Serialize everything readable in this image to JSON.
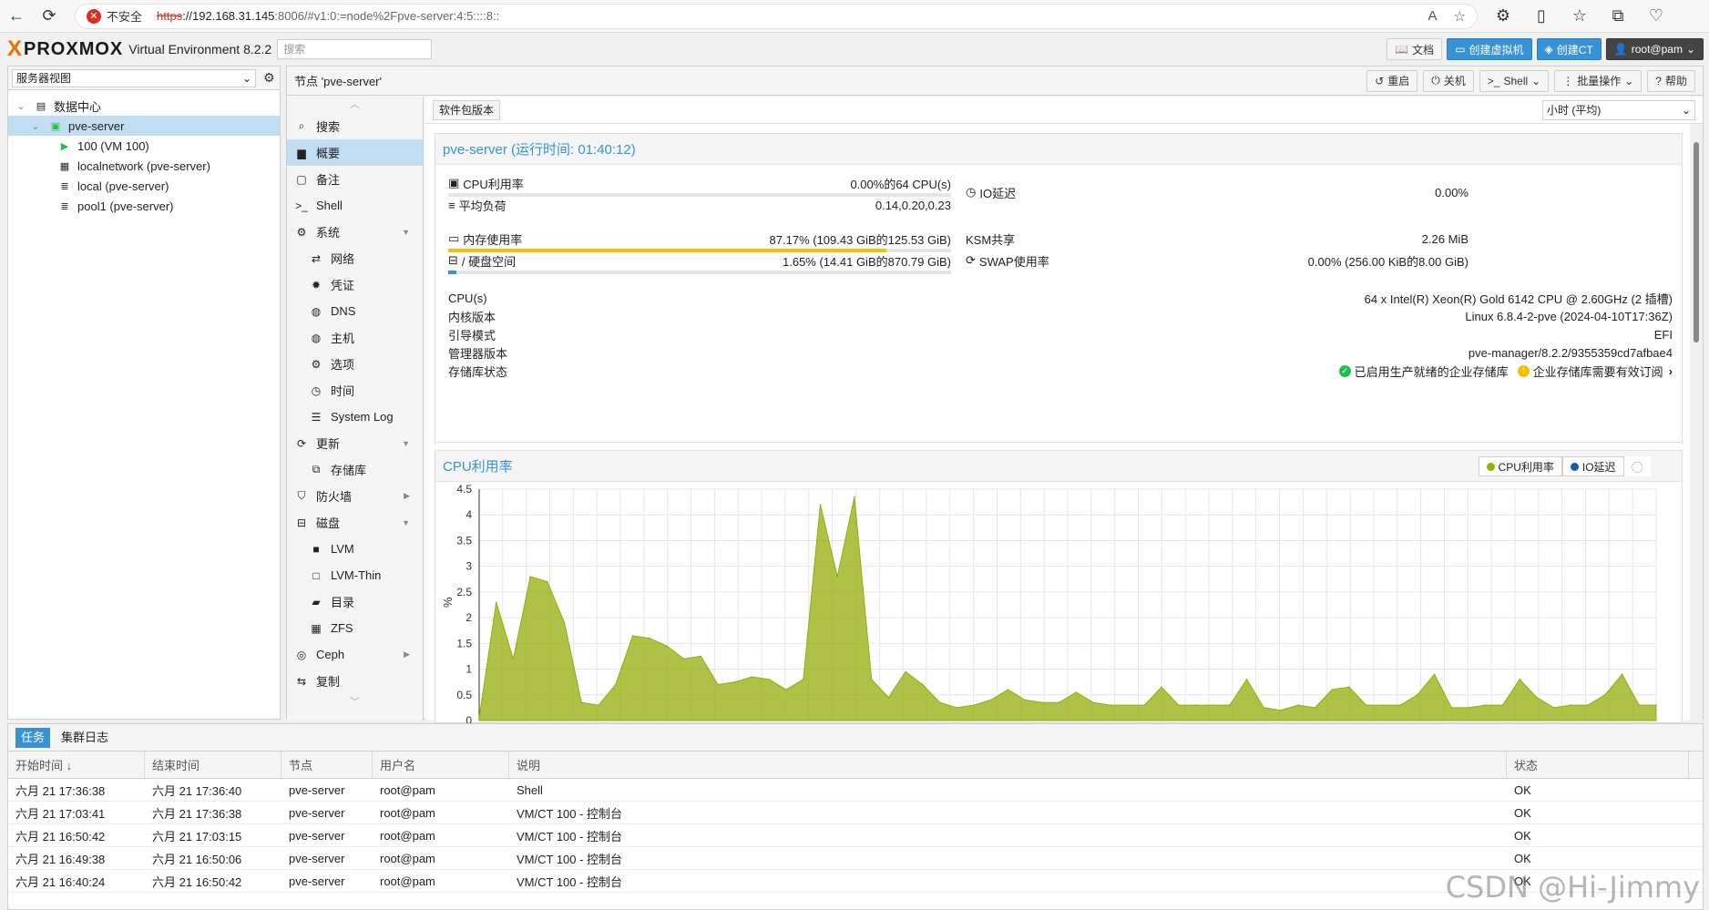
{
  "browser": {
    "insecure_label": "不安全",
    "url_scheme": "https",
    "url_host": "://192.168.31.145",
    "url_rest": ":8006/#v1:0:=node%2Fpve-server:4:5::::8::"
  },
  "header": {
    "logo_text": "PROXMOX",
    "version": "Virtual Environment 8.2.2",
    "search_placeholder": "搜索",
    "docs": "文档",
    "create_vm": "创建虚拟机",
    "create_ct": "创建CT",
    "user": "root@pam"
  },
  "tree": {
    "view": "服务器视图",
    "items": [
      {
        "label": "数据中心",
        "icon": "datacenter-icon"
      },
      {
        "label": "pve-server",
        "icon": "server-online-icon"
      },
      {
        "label": "100 (VM 100)",
        "icon": "vm-running-icon"
      },
      {
        "label": "localnetwork (pve-server)",
        "icon": "network-grid-icon"
      },
      {
        "label": "local (pve-server)",
        "icon": "storage-icon"
      },
      {
        "label": "pool1 (pve-server)",
        "icon": "storage-icon"
      }
    ]
  },
  "node": {
    "title": "节点 'pve-server'",
    "reboot": "重启",
    "shutdown": "关机",
    "shell": "Shell",
    "bulk": "批量操作",
    "help": "帮助"
  },
  "menu": [
    {
      "label": "搜索",
      "icon": "search-icon",
      "sub": false
    },
    {
      "label": "概要",
      "icon": "book-icon",
      "sub": false,
      "selected": true
    },
    {
      "label": "备注",
      "icon": "note-icon",
      "sub": false
    },
    {
      "label": "Shell",
      "icon": "terminal-icon",
      "sub": false
    },
    {
      "label": "系统",
      "icon": "cogs-icon",
      "sub": false,
      "arrow": "▼"
    },
    {
      "label": "网络",
      "icon": "exchange-icon",
      "sub": true
    },
    {
      "label": "凭证",
      "icon": "certificate-icon",
      "sub": true
    },
    {
      "label": "DNS",
      "icon": "globe-icon",
      "sub": true
    },
    {
      "label": "主机",
      "icon": "globe-icon",
      "sub": true
    },
    {
      "label": "选项",
      "icon": "gear-icon",
      "sub": true
    },
    {
      "label": "时间",
      "icon": "clock-icon",
      "sub": true
    },
    {
      "label": "System Log",
      "icon": "list-icon",
      "sub": true
    },
    {
      "label": "更新",
      "icon": "refresh-icon",
      "sub": false,
      "arrow": "▼"
    },
    {
      "label": "存储库",
      "icon": "files-icon",
      "sub": true
    },
    {
      "label": "防火墙",
      "icon": "shield-icon",
      "sub": false,
      "arrow": "▶"
    },
    {
      "label": "磁盘",
      "icon": "hdd-icon",
      "sub": false,
      "arrow": "▼"
    },
    {
      "label": "LVM",
      "icon": "square-icon",
      "sub": true
    },
    {
      "label": "LVM-Thin",
      "icon": "square-outline-icon",
      "sub": true
    },
    {
      "label": "目录",
      "icon": "folder-icon",
      "sub": true
    },
    {
      "label": "ZFS",
      "icon": "grid-icon",
      "sub": true
    },
    {
      "label": "Ceph",
      "icon": "ceph-icon",
      "sub": false,
      "arrow": "▶"
    },
    {
      "label": "复制",
      "icon": "retweet-icon",
      "sub": false
    }
  ],
  "content": {
    "pkg_versions": "软件包版本",
    "timeframe": "小时 (平均)",
    "summary_title": "pve-server (运行时间: 01:40:12)",
    "cpu_label": "CPU利用率",
    "cpu_value": "0.00%的64 CPU(s)",
    "cpu_fraction": 0.0,
    "load_label": "平均负荷",
    "load_value": "0.14,0.20,0.23",
    "io_label": "IO延迟",
    "io_value": "0.00%",
    "mem_label": "内存使用率",
    "mem_value": "87.17% (109.43 GiB的125.53 GiB)",
    "mem_fraction": 0.8717,
    "ksm_label": "KSM共享",
    "ksm_value": "2.26 MiB",
    "disk_label": "/ 硬盘空间",
    "disk_value": "1.65% (14.41 GiB的870.79 GiB)",
    "disk_fraction": 0.0165,
    "swap_label": "SWAP使用率",
    "swap_value": "0.00% (256.00 KiB的8.00 GiB)",
    "info": [
      {
        "label": "CPU(s)",
        "value": "64 x Intel(R) Xeon(R) Gold 6142 CPU @ 2.60GHz (2 插槽)"
      },
      {
        "label": "内核版本",
        "value": "Linux 6.8.4-2-pve (2024-04-10T17:36Z)"
      },
      {
        "label": "引导模式",
        "value": "EFI"
      },
      {
        "label": "管理器版本",
        "value": "pve-manager/8.2.2/9355359cd7afbae4"
      }
    ],
    "repo_label": "存储库状态",
    "repo_ok": "已启用生产就绪的企业存储库",
    "repo_warn": "企业存储库需要有效订阅"
  },
  "chart_data": {
    "type": "area",
    "title": "CPU利用率",
    "ylabel": "%",
    "ylim": [
      0,
      4.5
    ],
    "yticks": [
      "0",
      "0.5",
      "1",
      "1.5",
      "2",
      "2.5",
      "3",
      "3.5",
      "4",
      "4.5"
    ],
    "series": [
      {
        "name": "CPU利用率",
        "color": "#94ae0a",
        "values": [
          0.05,
          2.3,
          1.2,
          2.8,
          2.7,
          1.9,
          0.35,
          0.3,
          0.7,
          1.65,
          1.6,
          1.45,
          1.2,
          1.25,
          0.7,
          0.75,
          0.85,
          0.8,
          0.6,
          0.8,
          4.2,
          2.8,
          4.35,
          0.8,
          0.45,
          0.95,
          0.7,
          0.35,
          0.25,
          0.3,
          0.4,
          0.6,
          0.4,
          0.35,
          0.35,
          0.55,
          0.35,
          0.3,
          0.3,
          0.3,
          0.65,
          0.3,
          0.3,
          0.3,
          0.3,
          0.8,
          0.25,
          0.2,
          0.3,
          0.25,
          0.6,
          0.65,
          0.3,
          0.3,
          0.3,
          0.5,
          0.9,
          0.25,
          0.25,
          0.3,
          0.3,
          0.8,
          0.45,
          0.25,
          0.3,
          0.3,
          0.5,
          0.9,
          0.3,
          0.3
        ]
      },
      {
        "name": "IO延迟",
        "color": "#115fa6",
        "values": []
      }
    ],
    "legend": "top-right",
    "grid": true
  },
  "tasks": {
    "tab_tasks": "任务",
    "tab_cluster_log": "集群日志",
    "columns": [
      "开始时间 ↓",
      "结束时间",
      "节点",
      "用户名",
      "说明",
      "状态"
    ],
    "rows": [
      [
        "六月 21 17:36:38",
        "六月 21 17:36:40",
        "pve-server",
        "root@pam",
        "Shell",
        "OK"
      ],
      [
        "六月 21 17:03:41",
        "六月 21 17:36:38",
        "pve-server",
        "root@pam",
        "VM/CT 100 - 控制台",
        "OK"
      ],
      [
        "六月 21 16:50:42",
        "六月 21 17:03:15",
        "pve-server",
        "root@pam",
        "VM/CT 100 - 控制台",
        "OK"
      ],
      [
        "六月 21 16:49:38",
        "六月 21 16:50:06",
        "pve-server",
        "root@pam",
        "VM/CT 100 - 控制台",
        "OK"
      ],
      [
        "六月 21 16:40:24",
        "六月 21 16:50:42",
        "pve-server",
        "root@pam",
        "VM/CT 100 - 控制台",
        "OK"
      ]
    ]
  },
  "watermark": "CSDN @Hi-Jimmy"
}
